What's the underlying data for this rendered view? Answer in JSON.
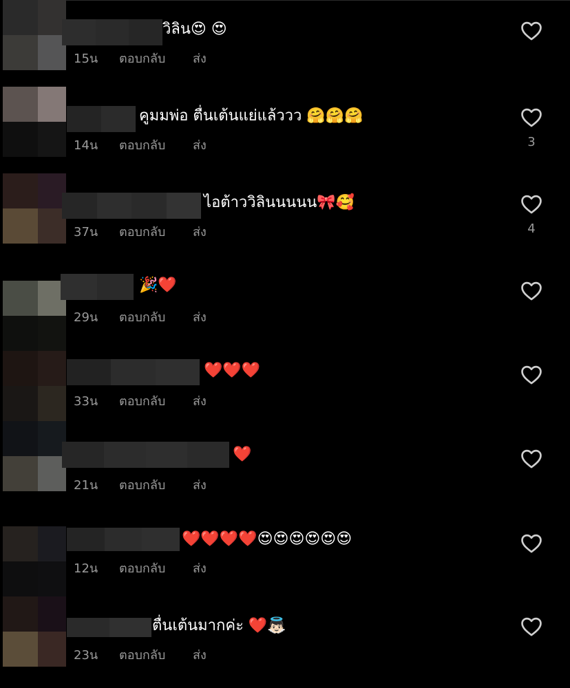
{
  "ui": {
    "reply_label": "ตอบกลับ",
    "send_label": "ส่ง"
  },
  "comments": [
    {
      "text": "วิลิน😍 😍",
      "time": "15น",
      "likes": ""
    },
    {
      "text": "คูมมพ่อ ตื่นเต้นแย่แล้ววว 🤗🤗🤗",
      "time": "14น",
      "likes": "3"
    },
    {
      "text": "ไอต้าววิลินนนนน🎀🥰",
      "time": "37น",
      "likes": "4"
    },
    {
      "text": "🎉❤️",
      "time": "29น",
      "likes": ""
    },
    {
      "text": "❤️❤️❤️",
      "time": "33น",
      "likes": ""
    },
    {
      "text": "❤️",
      "time": "21น",
      "likes": ""
    },
    {
      "text": "❤️❤️❤️❤️😍😍😍😍😍😍",
      "time": "12น",
      "likes": ""
    },
    {
      "text": "ตื่นเต้นมากค่ะ ❤️👼🏻",
      "time": "23น",
      "likes": ""
    }
  ],
  "colors": {
    "background": "#000000",
    "secondary_text": "#9a9a9a",
    "primary_text": "#ffffff"
  }
}
